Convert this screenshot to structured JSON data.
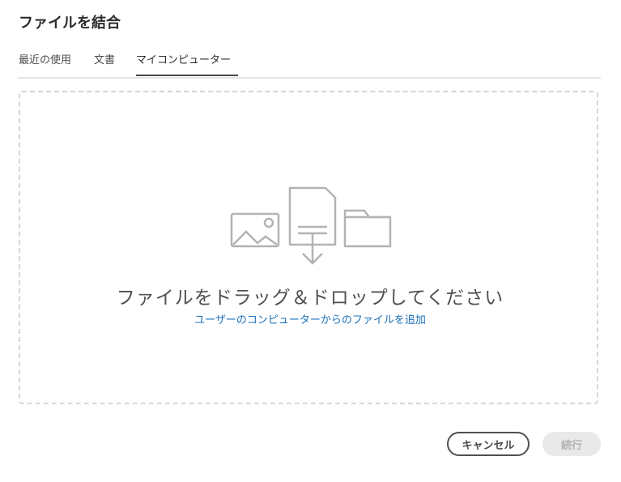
{
  "dialog": {
    "title": "ファイルを結合"
  },
  "tabs": [
    {
      "label": "最近の使用",
      "selected": false
    },
    {
      "label": "文書",
      "selected": false
    },
    {
      "label": "マイコンピューター",
      "selected": true
    }
  ],
  "dropzone": {
    "title": "ファイルをドラッグ＆ドロップしてください",
    "link": "ユーザーのコンピューターからのファイルを追加",
    "icons": [
      "image-icon",
      "document-download-icon",
      "folder-icon"
    ]
  },
  "footer": {
    "cancel_label": "キャンセル",
    "continue_label": "続行",
    "continue_enabled": false
  },
  "colors": {
    "link": "#1b6fb8",
    "icon_gray": "#b3b3b3",
    "dashed_border": "#d6d6d6"
  }
}
